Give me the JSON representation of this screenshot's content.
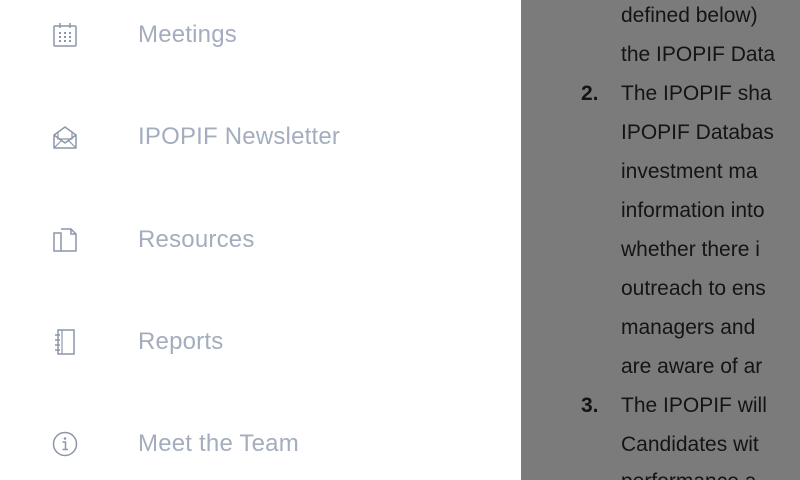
{
  "menu": {
    "items": [
      {
        "label": "Meetings",
        "icon": "calendar-icon"
      },
      {
        "label": "IPOPIF Newsletter",
        "icon": "envelope-icon"
      },
      {
        "label": "Resources",
        "icon": "documents-icon"
      },
      {
        "label": "Reports",
        "icon": "notebook-icon"
      },
      {
        "label": "Meet the Team",
        "icon": "info-icon"
      }
    ]
  },
  "document": {
    "lines": [
      "defined below)",
      "the IPOPIF Data",
      "The IPOPIF sha",
      "IPOPIF Databas",
      "investment ma",
      "information into",
      "whether there i",
      "outreach to ens",
      "managers and",
      "are aware of ar",
      "The IPOPIF will",
      "Candidates wit",
      "performance a"
    ],
    "numbers": [
      "2.",
      "3."
    ]
  },
  "colors": {
    "menu_text": "#a4adbe",
    "icon_stroke": "#8c96aa",
    "overlay": "#7b7b7b",
    "doc_text": "#141414"
  }
}
